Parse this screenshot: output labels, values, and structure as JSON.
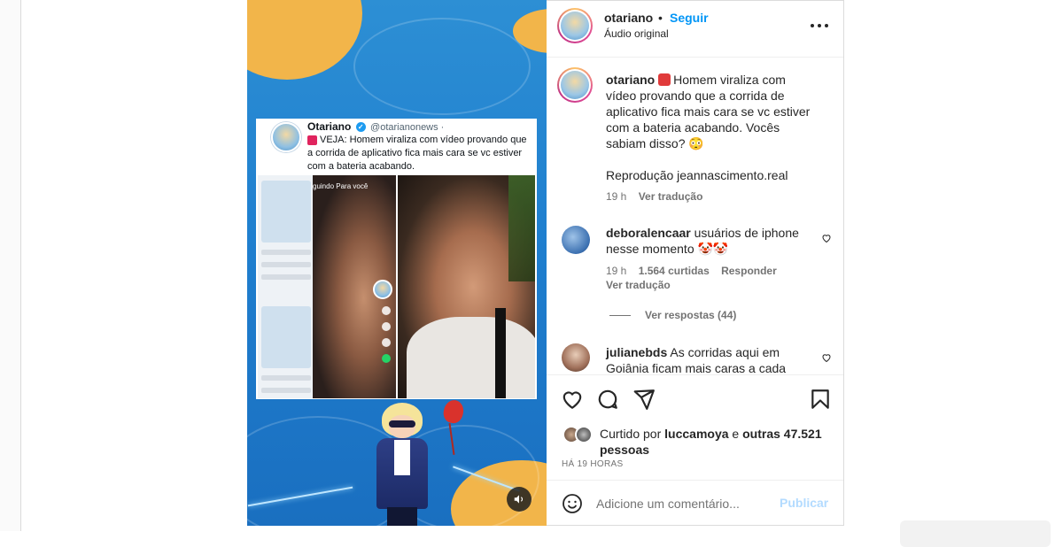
{
  "post": {
    "username": "otariano",
    "follow_label": "Seguir",
    "audio_label": "Áudio original"
  },
  "media": {
    "tweet": {
      "name": "Otariano",
      "handle": "@otarianonews ·",
      "text": "VEJA: Homem viraliza com vídeo provando que a corrida de aplicativo fica mais cara se vc estiver com a bateria acabando."
    },
    "video_topbar": "guindo  Para você"
  },
  "caption": {
    "username": "otariano",
    "text": "Homem viraliza com vídeo provando que a corrida de aplicativo fica mais cara se vc estiver com a bateria acabando. Vocês sabiam disso? 😳",
    "credit": "Reprodução jeannascimento.real",
    "time": "19 h",
    "translate_label": "Ver tradução"
  },
  "comments": [
    {
      "username": "deboralencaar",
      "text": "usuários de iphone nesse momento 🤡🤡",
      "time": "19 h",
      "likes": "1.564 curtidas",
      "reply_label": "Responder",
      "translate_label": "Ver tradução",
      "view_replies": "Ver respostas (44)"
    },
    {
      "username": "julianebds",
      "text": "As corridas aqui em Goiânia ficam mais caras a cada"
    }
  ],
  "likes": {
    "prefix": "Curtido por",
    "user": "luccamoya",
    "middle": "e",
    "others": "outras 47.521 pessoas",
    "time_ago": "HÁ 19 HORAS"
  },
  "add_comment": {
    "placeholder": "Adicione um comentário...",
    "publish_label": "Publicar"
  },
  "colors": {
    "accent": "#0095f6",
    "publish_disabled": "#b3dbff",
    "muted_text": "#737373"
  },
  "icons": [
    "more-icon",
    "heart-icon",
    "comment-icon",
    "share-icon",
    "bookmark-icon",
    "emoji-icon",
    "volume-icon",
    "verified-icon"
  ]
}
